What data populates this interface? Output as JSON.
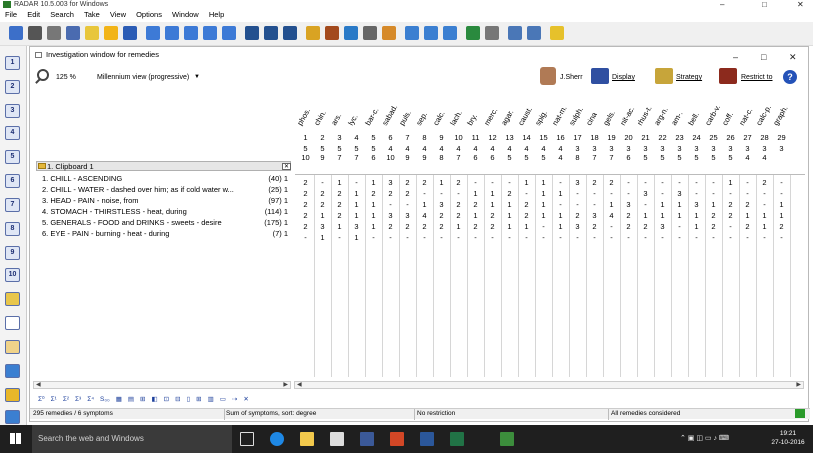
{
  "app": {
    "title": "RADAR 10.5.003 for Windows",
    "minimize": "–",
    "maximize": "□",
    "close": "✕"
  },
  "menu": [
    "File",
    "Edit",
    "Search",
    "Take",
    "View",
    "Options",
    "Window",
    "Help"
  ],
  "inv": {
    "title": "Investigation window for remedies",
    "minimize": "–",
    "maximize": "□",
    "close": "✕"
  },
  "ctrl": {
    "zoom": "125 %",
    "view": "Millennium view (progressive)",
    "dropdown": "▼",
    "user": "J.Sherr",
    "display": "Display",
    "strategy": "Strategy",
    "restrict": "Restrict to",
    "help": "?"
  },
  "leftbar": [
    "1",
    "2",
    "3",
    "4",
    "5",
    "6",
    "7",
    "8",
    "9",
    "10"
  ],
  "clipboard": {
    "number": "1.",
    "label": "Clipboard 1",
    "close": "✕"
  },
  "symptoms": [
    {
      "text": "1. CHILL - ASCENDING",
      "count": "(40) 1"
    },
    {
      "text": "2. CHILL - WATER - dashed over him; as if cold water w...",
      "count": "(25) 1"
    },
    {
      "text": "3. HEAD - PAIN - noise, from",
      "count": "(97) 1"
    },
    {
      "text": "4. STOMACH - THIRSTLESS - heat, during",
      "count": "(114) 1"
    },
    {
      "text": "5. GENERALS - FOOD and DRINKS - sweets - desire",
      "count": "(175) 1"
    },
    {
      "text": "6. EYE - PAIN - burning - heat - during",
      "count": "(7) 1"
    }
  ],
  "remedies": {
    "names": [
      "phos.",
      "chin.",
      "ars.",
      "lyc.",
      "bar-c.",
      "sabad.",
      "puls.",
      "sep.",
      "calc.",
      "lach.",
      "bry.",
      "merc.",
      "agar.",
      "caust.",
      "spig.",
      "nat-m.",
      "sulph.",
      "cina",
      "gels.",
      "nit-ac.",
      "rhus-t.",
      "arg-n.",
      "am-.",
      "bell.",
      "carb-v.",
      "coff.",
      "nat-c.",
      "calc-p.",
      "graph."
    ],
    "numbers": [
      "1",
      "2",
      "3",
      "4",
      "5",
      "6",
      "7",
      "8",
      "9",
      "10",
      "11",
      "12",
      "13",
      "14",
      "15",
      "16",
      "17",
      "18",
      "19",
      "20",
      "21",
      "22",
      "23",
      "24",
      "25",
      "26",
      "27",
      "28",
      "29"
    ],
    "row_a": [
      "5",
      "5",
      "5",
      "5",
      "5",
      "4",
      "4",
      "4",
      "4",
      "4",
      "4",
      "4",
      "4",
      "4",
      "4",
      "4",
      "3",
      "3",
      "3",
      "3",
      "3",
      "3",
      "3",
      "3",
      "3",
      "3",
      "3",
      "3",
      "3"
    ],
    "row_b": [
      "10",
      "9",
      "7",
      "7",
      "6",
      "10",
      "9",
      "9",
      "8",
      "7",
      "6",
      "6",
      "5",
      "5",
      "5",
      "4",
      "8",
      "7",
      "7",
      "6",
      "5",
      "5",
      "5",
      "5",
      "5",
      "5",
      "4",
      "4"
    ],
    "grid": [
      [
        "2",
        "-",
        "1",
        "-",
        "1",
        "3",
        "2",
        "2",
        "1",
        "2",
        "-",
        "-",
        "-",
        "1",
        "1",
        "-",
        "3",
        "2",
        "2",
        "-",
        "-",
        "-",
        "-",
        "-",
        "-",
        "1",
        "-",
        "2",
        "-"
      ],
      [
        "2",
        "2",
        "2",
        "1",
        "2",
        "2",
        "2",
        "-",
        "-",
        "-",
        "1",
        "1",
        "2",
        "-",
        "1",
        "1",
        "-",
        "-",
        "-",
        "-",
        "3",
        "-",
        "3",
        "-",
        "-",
        "-",
        "-",
        "-",
        "-"
      ],
      [
        "2",
        "2",
        "2",
        "1",
        "1",
        "-",
        "-",
        "1",
        "3",
        "2",
        "2",
        "1",
        "1",
        "2",
        "1",
        "-",
        "-",
        "-",
        "1",
        "3",
        "-",
        "1",
        "1",
        "3",
        "1",
        "2",
        "2",
        "-",
        "1"
      ],
      [
        "2",
        "1",
        "2",
        "1",
        "1",
        "3",
        "3",
        "4",
        "2",
        "2",
        "1",
        "2",
        "1",
        "2",
        "1",
        "1",
        "2",
        "3",
        "4",
        "2",
        "1",
        "1",
        "1",
        "1",
        "2",
        "2",
        "1",
        "1",
        "1"
      ],
      [
        "2",
        "3",
        "1",
        "3",
        "1",
        "2",
        "2",
        "2",
        "2",
        "1",
        "2",
        "2",
        "1",
        "1",
        "-",
        "1",
        "3",
        "2",
        "-",
        "2",
        "2",
        "3",
        "-",
        "1",
        "2",
        "-",
        "2",
        "1",
        "2"
      ],
      [
        "-",
        "1",
        "-",
        "1",
        "-",
        "-",
        "-",
        "-",
        "-",
        "-",
        "-",
        "-",
        "-",
        "-",
        "-",
        "-",
        "-",
        "-",
        "-",
        "-",
        "-",
        "-",
        "-",
        "-",
        "-",
        "-",
        "-",
        "-",
        "-"
      ]
    ]
  },
  "bottom_tools": [
    "Σ⁰",
    "Σ¹",
    "Σ²",
    "Σ³",
    "Σ⁴",
    "S₀₀",
    "▦",
    "▤",
    "⊞",
    "◧",
    "⊡",
    "⊟",
    "▯",
    "⊞",
    "▥",
    "▭",
    "⇢",
    "✕"
  ],
  "status": {
    "a": "295 remedies / 6 symptoms",
    "b": "Sum of symptoms, sort: degree",
    "c": "No restriction",
    "d": "All remedies considered"
  },
  "taskbar": {
    "search": "Search the web and Windows",
    "time": "19:21",
    "date": "27-10-2016"
  },
  "colors": {
    "accent": "#1c2e73",
    "folder": "#e4b73a",
    "taskbar": "#1f1f1f"
  }
}
